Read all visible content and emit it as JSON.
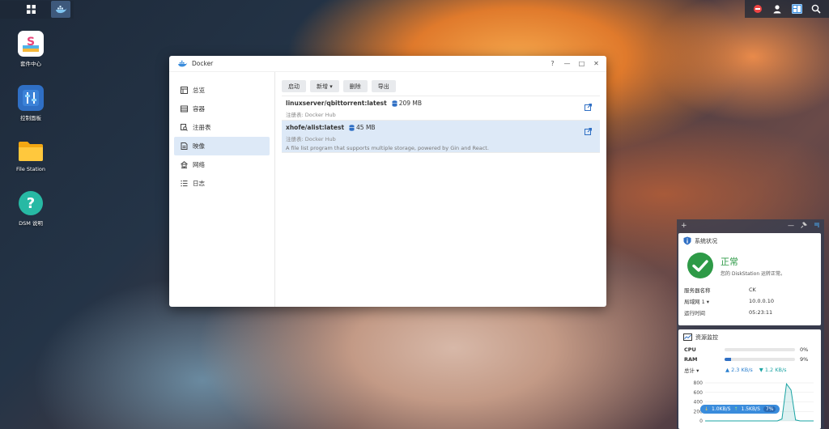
{
  "desktop": {
    "icons": [
      {
        "label": "套件中心"
      },
      {
        "label": "控制面板"
      },
      {
        "label": "File Station"
      },
      {
        "label": "DSM 说明"
      }
    ]
  },
  "window": {
    "title": "Docker",
    "controls": {
      "help": "?",
      "minimize": "—",
      "maximize": "□",
      "close": "✕"
    },
    "sidebar": [
      {
        "label": "总览"
      },
      {
        "label": "容器"
      },
      {
        "label": "注册表"
      },
      {
        "label": "映像"
      },
      {
        "label": "网络"
      },
      {
        "label": "日志"
      }
    ],
    "toolbar": {
      "start": "启动",
      "new": "新增 ▾",
      "delete": "删除",
      "export": "导出"
    },
    "images": [
      {
        "name": "linuxserver/qbittorrent:latest",
        "size": "209 MB",
        "registry": "注册表: Docker Hub",
        "description": ""
      },
      {
        "name": "xhofe/alist:latest",
        "size": "45 MB",
        "registry": "注册表: Docker Hub",
        "description": "A file list program that supports multiple storage, powered by Gin and React."
      }
    ]
  },
  "widgets": {
    "panel_bar": {
      "add": "+",
      "min": "—",
      "pin": "📌"
    },
    "system_status": {
      "title": "系统状况",
      "status": "正常",
      "message": "您的 DiskStation 运转正常。",
      "rows": [
        {
          "key": "服务器名称",
          "value": "CK"
        },
        {
          "key": "局域网 1 ▾",
          "value": "10.0.0.10"
        },
        {
          "key": "运行时间",
          "value": "05:23:11"
        }
      ]
    },
    "resource_monitor": {
      "title": "资源监控",
      "cpu": {
        "label": "CPU",
        "value": "0%",
        "level": 0
      },
      "ram": {
        "label": "RAM",
        "value": "9%",
        "level": 9
      },
      "net": {
        "label": "总计 ▾",
        "up": "2.3 KB/s",
        "down": "1.2 KB/s"
      },
      "legend": {
        "down": "1.0KB/S",
        "up": "1.5KB/S",
        "pct": "7%"
      }
    }
  },
  "chart_data": {
    "type": "area",
    "ylim": [
      0,
      800
    ],
    "yticks": [
      "800",
      "600",
      "400",
      "200",
      "0"
    ],
    "series": [
      {
        "values": [
          0,
          0,
          0,
          0,
          0,
          0,
          0,
          0,
          0,
          0,
          0,
          0,
          0,
          0,
          0,
          0,
          0,
          40,
          780,
          650,
          20,
          0,
          0,
          0,
          0
        ]
      }
    ]
  },
  "colors": {
    "accent": "#2f6fc4",
    "ok": "#2e9a47",
    "selected_row": "#dde9f7"
  }
}
